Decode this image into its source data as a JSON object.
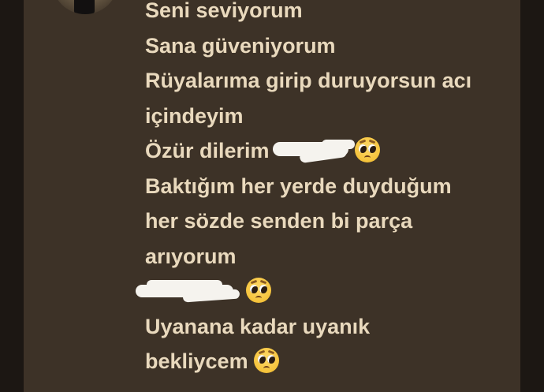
{
  "message": {
    "lines": [
      {
        "text": "Seni seviyorum"
      },
      {
        "text": "Sana güveniyorum"
      },
      {
        "text": "Rüyalarıma girip duruyorsun acı"
      },
      {
        "text": "içindeyim"
      },
      {
        "text": "Özür dilerim",
        "redacted": true,
        "emoji": "pleading-face"
      },
      {
        "text": "Baktığım her yerde duyduğum"
      },
      {
        "text": "her sözde senden bi parça"
      },
      {
        "text": "arıyorum"
      },
      {
        "text": "",
        "redacted": true,
        "emoji": "pleading-face"
      },
      {
        "text": "Uyanana kadar uyanık"
      },
      {
        "text": "bekliycem",
        "emoji": "pleading-face"
      }
    ]
  },
  "colors": {
    "background": "#221c17",
    "panel": "#3d3227",
    "text": "#e9d9bd",
    "redaction": "#f5f3ee"
  },
  "icons": {
    "emoji": "pleading-face-emoji",
    "avatar": "user-avatar"
  }
}
